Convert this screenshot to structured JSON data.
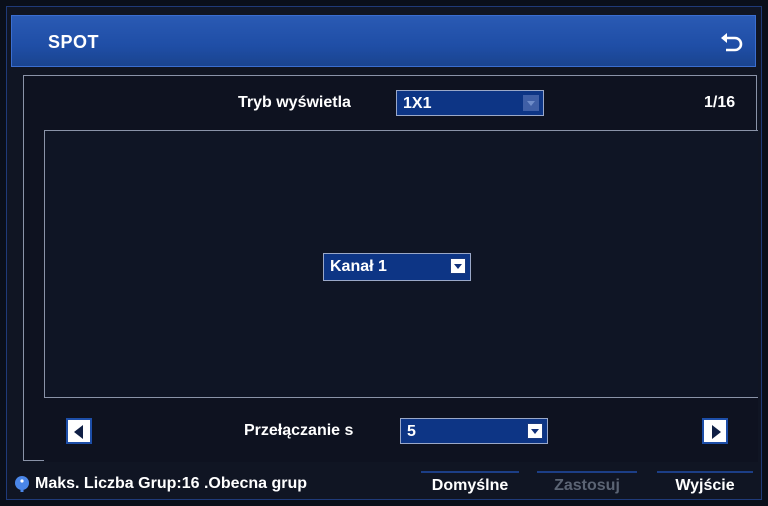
{
  "window": {
    "title": "SPOT",
    "back_icon": "back-arrow-icon"
  },
  "display_mode": {
    "label": "Tryb wyświetla",
    "value": "1X1"
  },
  "page_indicator": "1/16",
  "channel": {
    "value": "Kanał 1"
  },
  "switching": {
    "label": "Przełączanie s",
    "value": "5"
  },
  "footer": {
    "info": "Maks. Liczba Grup:16 .Obecna grup",
    "default_label": "Domyślne",
    "apply_label": "Zastosuj",
    "exit_label": "Wyjście"
  },
  "colors": {
    "titlebar": "#1f4ea6",
    "dropdown": "#0d3585",
    "background": "#101523",
    "disabled_text": "#5b6474"
  }
}
